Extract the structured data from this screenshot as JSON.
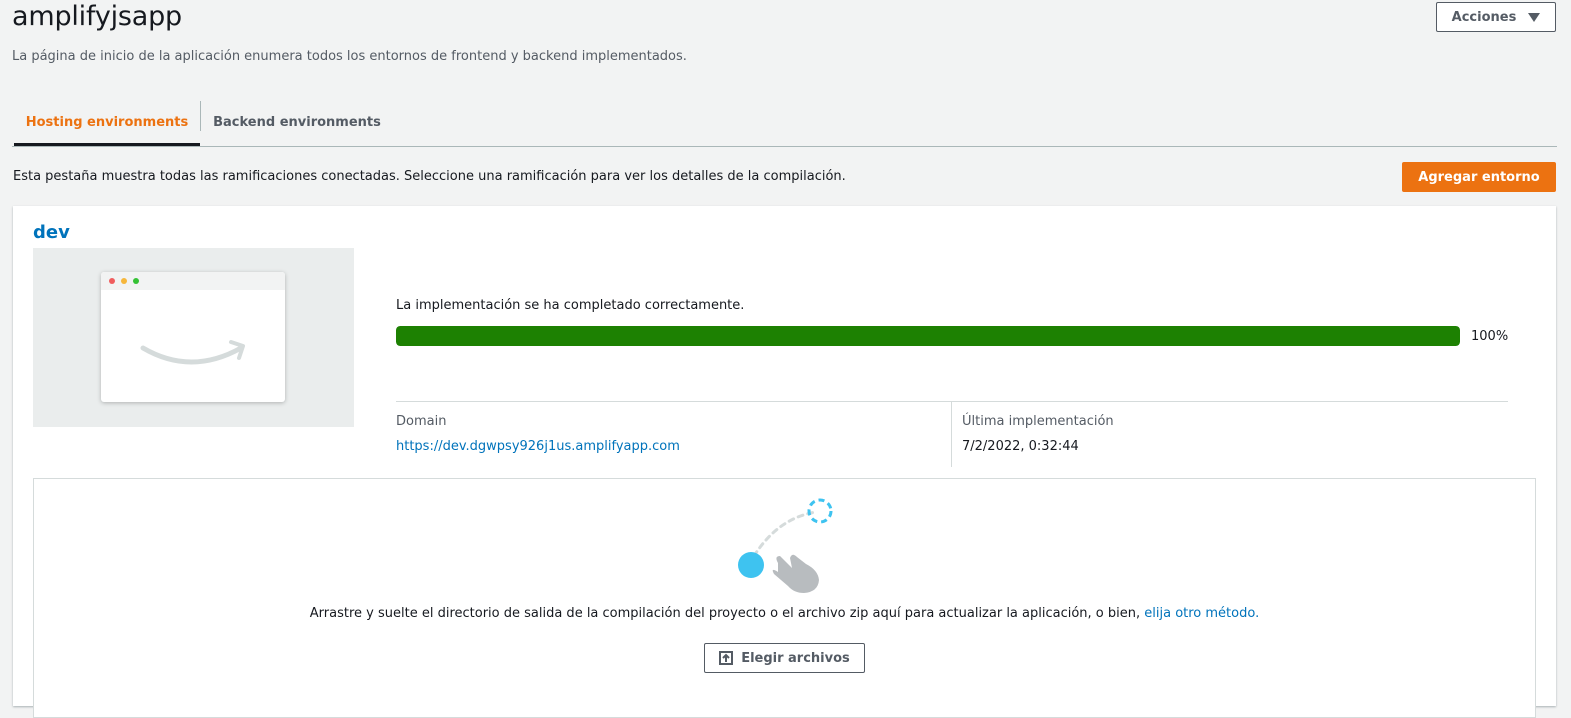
{
  "header": {
    "title": "amplifyjsapp",
    "description": "La página de inicio de la aplicación enumera todos los entornos de frontend y backend implementados.",
    "actions_label": "Acciones"
  },
  "tabs": [
    {
      "label": "Hosting environments",
      "active": true
    },
    {
      "label": "Backend environments",
      "active": false
    }
  ],
  "hosting": {
    "info_text": "Esta pestaña muestra todas las ramificaciones conectadas. Seleccione una ramificación para ver los detalles de la compilación.",
    "add_button": "Agregar entorno"
  },
  "branch": {
    "name": "dev",
    "status_text": "La implementación se ha completado correctamente.",
    "progress": 100,
    "progress_label": "100%",
    "domain_label": "Domain",
    "domain_url": "https://dev.dgwpsy926j1us.amplifyapp.com",
    "last_deploy_label": "Última implementación",
    "last_deploy_value": "7/2/2022, 0:32:44"
  },
  "dropzone": {
    "text": "Arrastre y suelte el directorio de salida de la compilación del proyecto o el archivo zip aquí para actualizar la aplicación, o bien, ",
    "link_text": "elija otro método.",
    "button_label": "Elegir archivos"
  },
  "colors": {
    "accent": "#ec7211",
    "link": "#0073bb",
    "success": "#1d8102"
  }
}
